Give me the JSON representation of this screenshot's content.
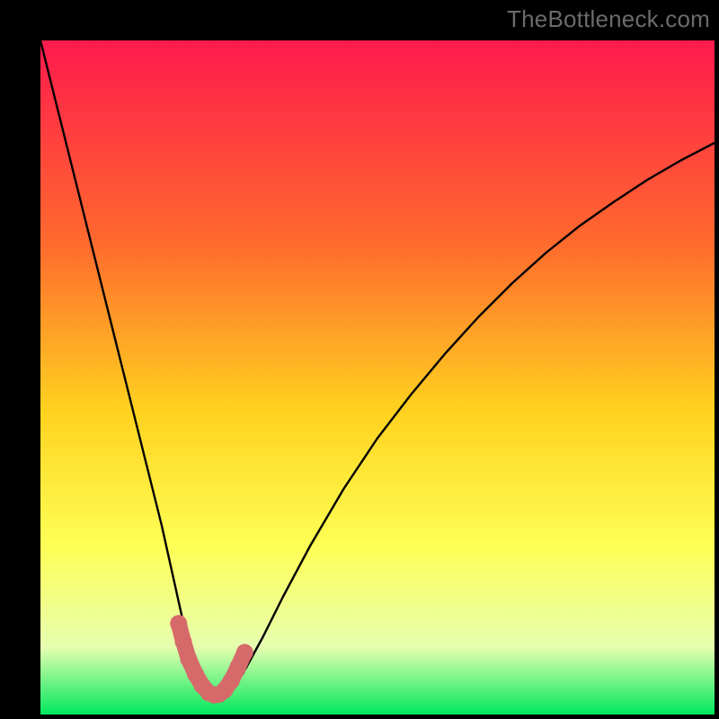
{
  "watermark": "TheBottleneck.com",
  "chart_data": {
    "type": "line",
    "title": "",
    "xlabel": "",
    "ylabel": "",
    "xlim": [
      0,
      100
    ],
    "ylim": [
      0,
      100
    ],
    "gradient_stops": [
      {
        "offset": 0,
        "color": "#ff1a4d"
      },
      {
        "offset": 30,
        "color": "#ff6a2e"
      },
      {
        "offset": 55,
        "color": "#ffd21f"
      },
      {
        "offset": 75,
        "color": "#feff55"
      },
      {
        "offset": 90,
        "color": "#e6ffb0"
      },
      {
        "offset": 100,
        "color": "#00e85e"
      }
    ],
    "series": [
      {
        "name": "curve",
        "color": "#000000",
        "x": [
          0,
          2,
          4,
          6,
          8,
          10,
          12,
          14,
          16,
          18,
          20,
          21,
          22,
          23,
          24,
          25,
          26,
          27,
          28,
          30,
          33,
          36,
          40,
          45,
          50,
          55,
          60,
          65,
          70,
          75,
          80,
          85,
          90,
          95,
          100
        ],
        "y": [
          100,
          92,
          84,
          76,
          68,
          60,
          52,
          44,
          36,
          28,
          19,
          14.5,
          10.5,
          7.5,
          5.2,
          3.7,
          3.0,
          3.0,
          3.6,
          6.0,
          11.5,
          17.5,
          25.0,
          33.5,
          41.0,
          47.5,
          53.5,
          59.0,
          64.0,
          68.5,
          72.5,
          76.0,
          79.3,
          82.2,
          84.8
        ]
      },
      {
        "name": "highlight",
        "color": "#d66a6a",
        "x": [
          20.5,
          21.2,
          22.0,
          23.0,
          24.0,
          25.0,
          25.8,
          26.5,
          27.3,
          28.3,
          29.3,
          30.3
        ],
        "y": [
          13.5,
          10.8,
          8.2,
          6.0,
          4.3,
          3.2,
          2.9,
          3.0,
          3.6,
          5.0,
          7.0,
          9.2
        ]
      }
    ]
  }
}
